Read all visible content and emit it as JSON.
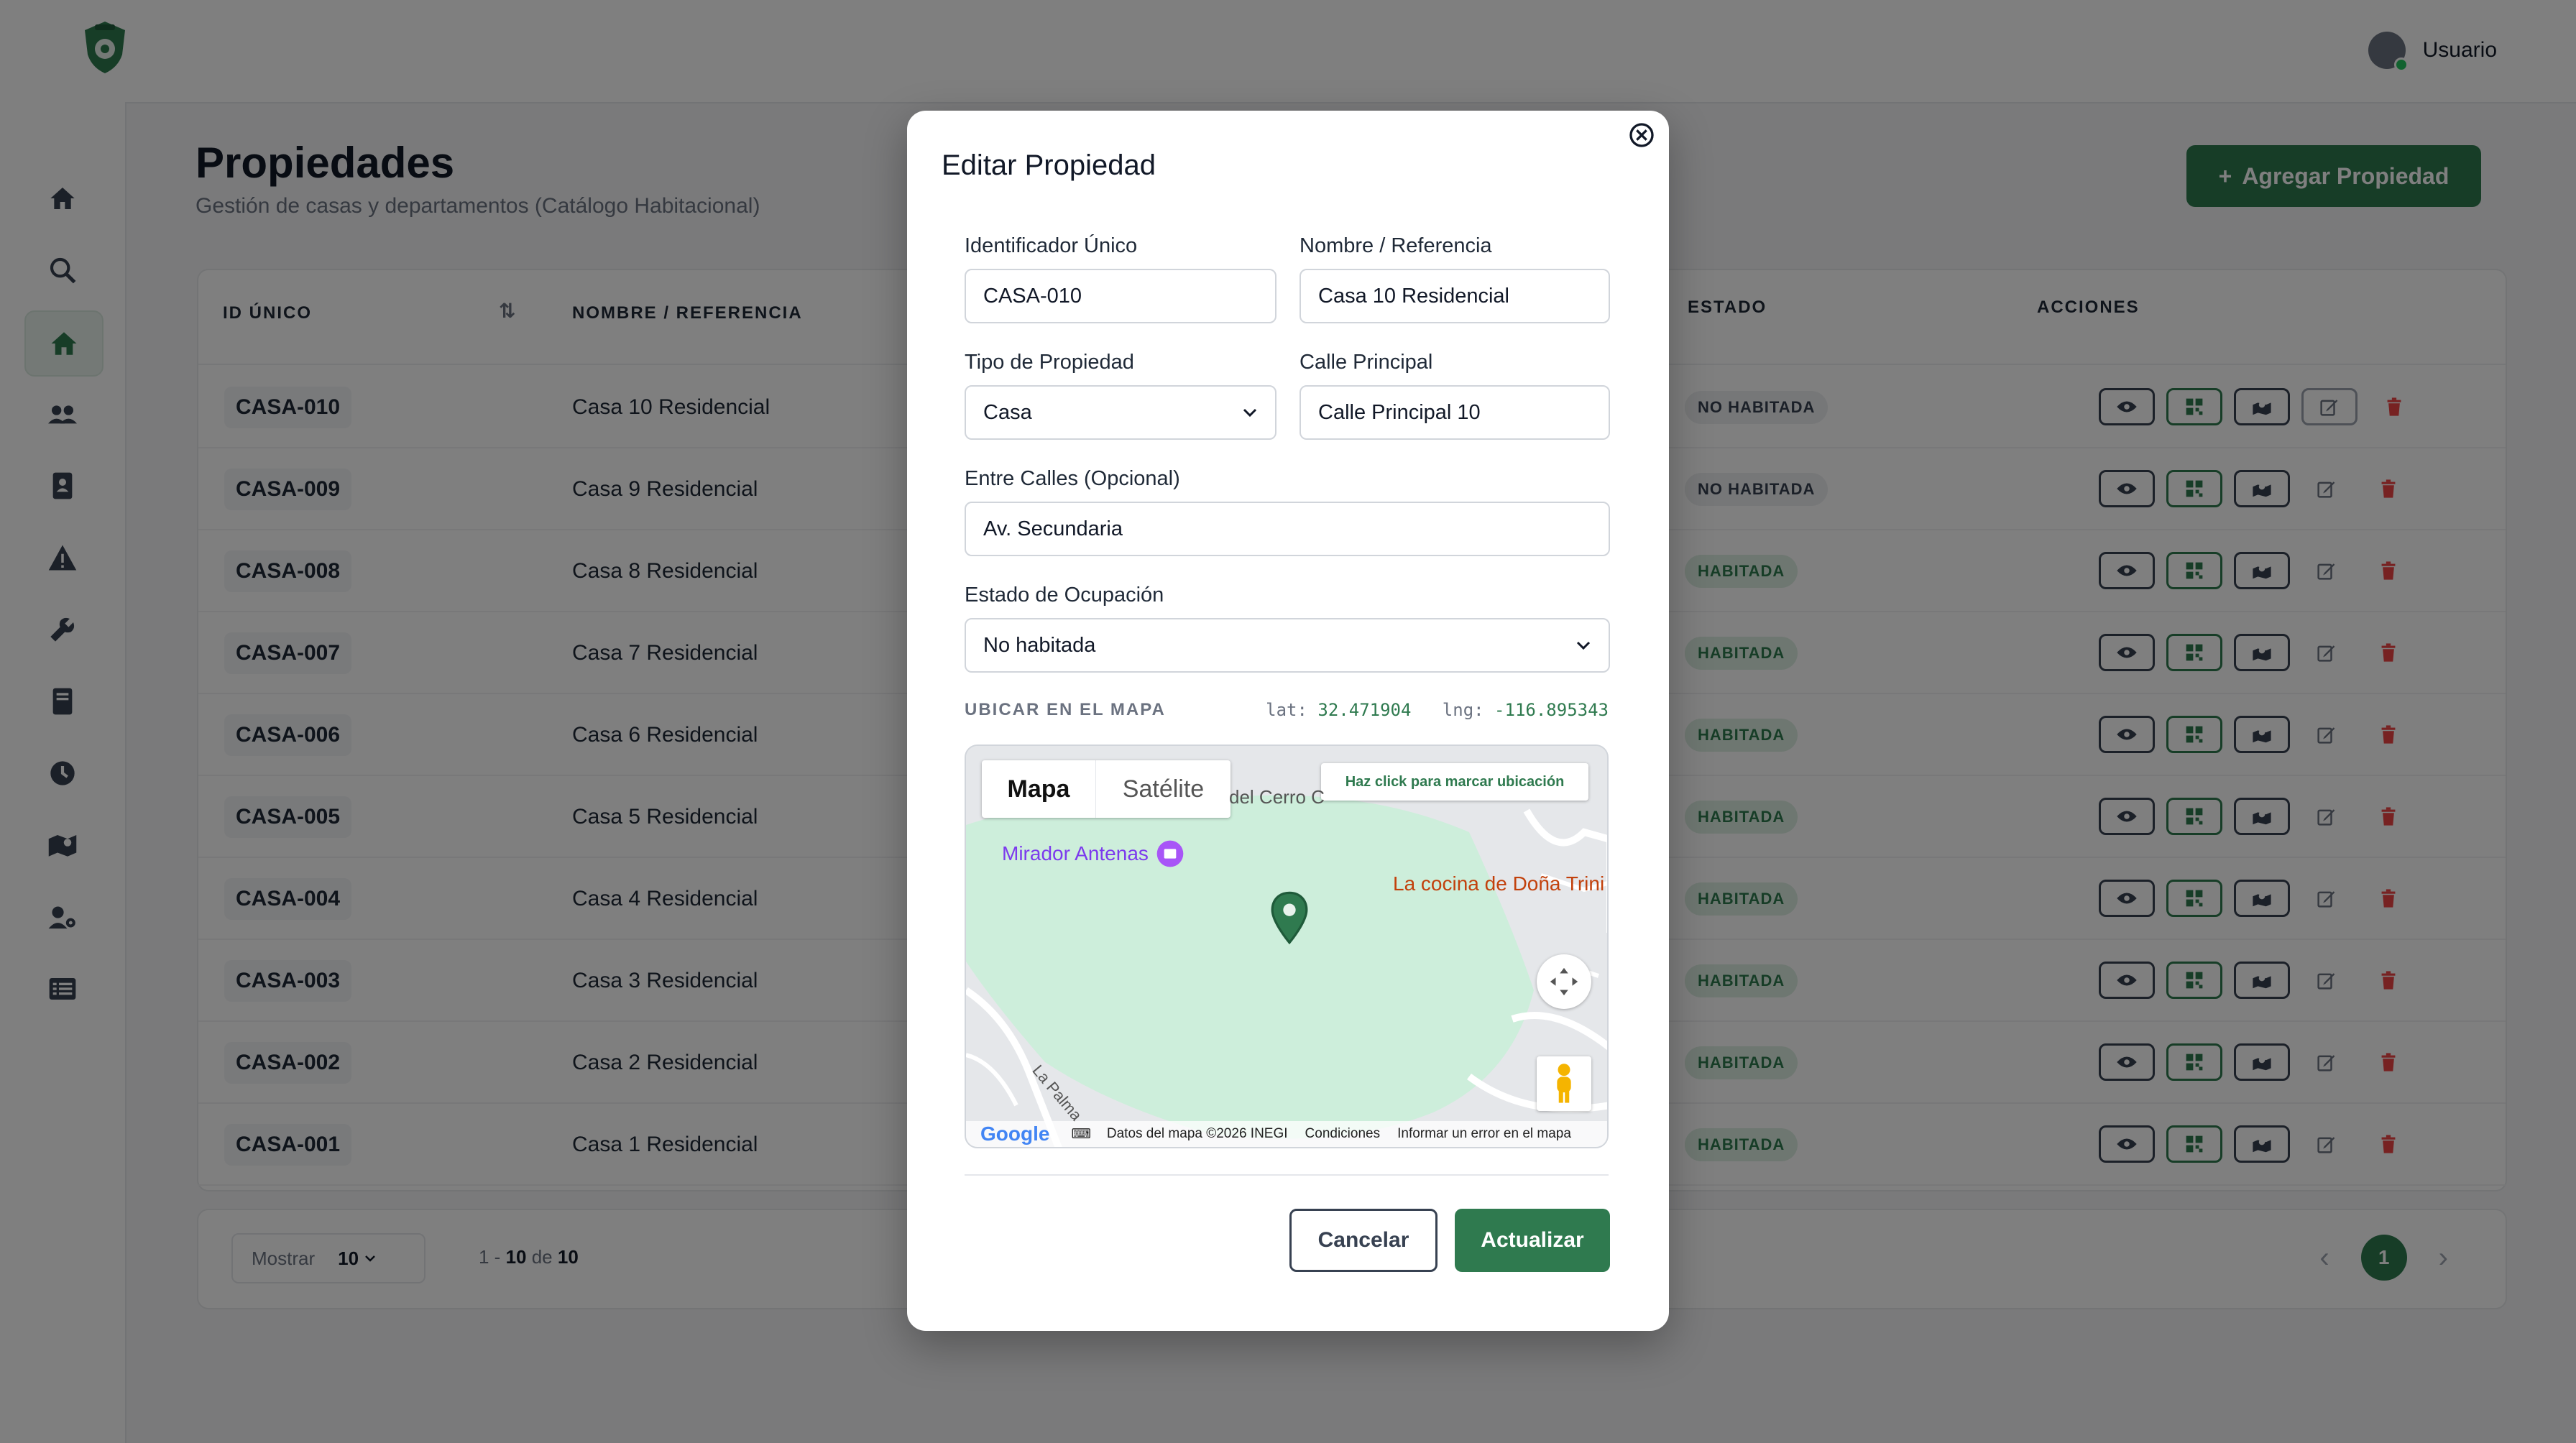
{
  "header": {
    "user_name": "Usuario",
    "user_icon": "user-circle-icon",
    "logo_icon": "shield-logo-icon"
  },
  "sidebar": {
    "items": [
      {
        "icon": "home-icon"
      },
      {
        "icon": "search-home-icon"
      },
      {
        "icon": "house-icon",
        "active": true
      },
      {
        "icon": "users-icon"
      },
      {
        "icon": "address-book-icon"
      },
      {
        "icon": "warning-icon"
      },
      {
        "icon": "wrench-icon"
      },
      {
        "icon": "book-icon"
      },
      {
        "icon": "clock-icon"
      },
      {
        "icon": "map-icon"
      },
      {
        "icon": "user-cog-icon"
      },
      {
        "icon": "list-icon"
      }
    ]
  },
  "page": {
    "title": "Propiedades",
    "subtitle": "Gestión de casas y departamentos (Catálogo Habitacional)",
    "add_button": "Agregar Propiedad",
    "add_icon": "+"
  },
  "table": {
    "columns": {
      "id": "ID ÚNICO",
      "name": "NOMBRE / REFERENCIA",
      "state": "ESTADO",
      "actions": "ACCIONES"
    },
    "sort_icon": "⇅",
    "rows": [
      {
        "id": "CASA-010",
        "name": "Casa 10 Residencial",
        "status": "NO HABITADA"
      },
      {
        "id": "CASA-009",
        "name": "Casa 9 Residencial",
        "status": "NO HABITADA"
      },
      {
        "id": "CASA-008",
        "name": "Casa 8 Residencial",
        "status": "HABITADA"
      },
      {
        "id": "CASA-007",
        "name": "Casa 7 Residencial",
        "status": "HABITADA"
      },
      {
        "id": "CASA-006",
        "name": "Casa 6 Residencial",
        "status": "HABITADA"
      },
      {
        "id": "CASA-005",
        "name": "Casa 5 Residencial",
        "status": "HABITADA"
      },
      {
        "id": "CASA-004",
        "name": "Casa 4 Residencial",
        "status": "HABITADA"
      },
      {
        "id": "CASA-003",
        "name": "Casa 3 Residencial",
        "status": "HABITADA"
      },
      {
        "id": "CASA-002",
        "name": "Casa 2 Residencial",
        "status": "HABITADA"
      },
      {
        "id": "CASA-001",
        "name": "Casa 1 Residencial",
        "status": "HABITADA"
      }
    ]
  },
  "footer": {
    "show_label": "Mostrar",
    "page_size": "10",
    "range_start": "1 - ",
    "range_end": "10",
    "range_of": " de ",
    "total": "10",
    "current_page": "1",
    "prev_icon": "‹",
    "next_icon": "›"
  },
  "modal": {
    "title": "Editar Propiedad",
    "close_icon": "close-circle-icon",
    "fields": {
      "id_label": "Identificador Único",
      "id_value": "CASA-010",
      "name_label": "Nombre / Referencia",
      "name_value": "Casa 10 Residencial",
      "type_label": "Tipo de Propiedad",
      "type_value": "Casa",
      "street_label": "Calle Principal",
      "street_value": "Calle Principal 10",
      "cross_label": "Entre Calles (Opcional)",
      "cross_value": "Av. Secundaria",
      "occupancy_label": "Estado de Ocupación",
      "occupancy_value": "No habitada"
    },
    "map": {
      "section_label": "UBICAR EN EL MAPA",
      "lat_label": "lat:",
      "lat_value": "32.471904",
      "lng_label": "lng:",
      "lng_value": "-116.895343",
      "tab_map": "Mapa",
      "tab_satellite": "Satélite",
      "hint": "Haz click para marcar ubicación",
      "place_1": "Mirador Antenas",
      "place_2": "La cocina de Doña Trini",
      "place_3": "del Cerro C",
      "street_1": "La Palma",
      "attribution": "Datos del mapa ©2026 INEGI",
      "terms": "Condiciones",
      "report": "Informar un error en el mapa",
      "google": "Google"
    },
    "cancel": "Cancelar",
    "submit": "Actualizar"
  },
  "colors": {
    "accent": "#2f7a4f",
    "badge_green_bg": "#dcefe3",
    "badge_grey_bg": "#eceef1",
    "delete": "#ef4444"
  }
}
